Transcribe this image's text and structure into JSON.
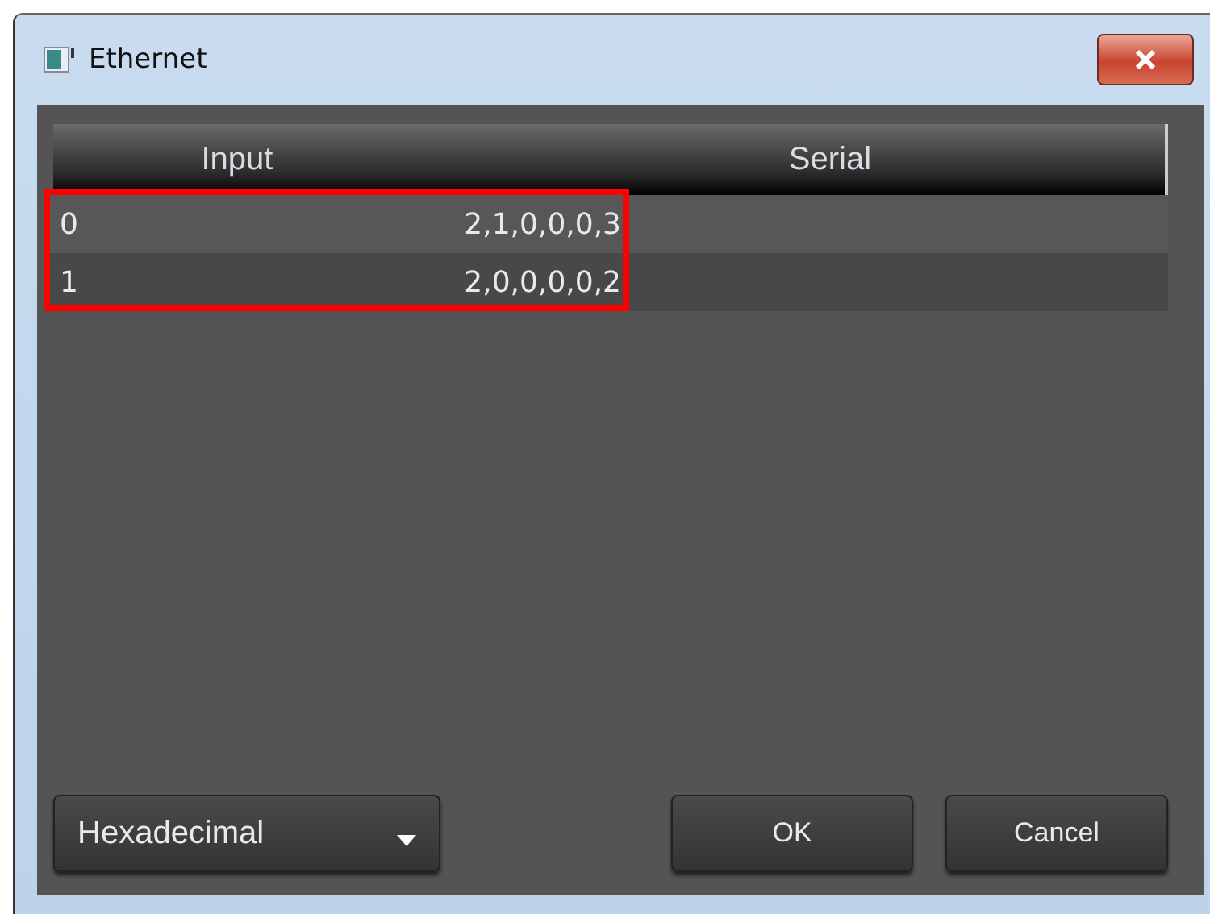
{
  "window": {
    "title": "Ethernet"
  },
  "table": {
    "columns": [
      "Input",
      "Serial"
    ],
    "rows": [
      {
        "cells": [
          "0",
          "2,1,0,0,0,3"
        ],
        "highlighted": true
      },
      {
        "cells": [
          "1",
          "2,0,0,0,0,2"
        ],
        "highlighted": true
      }
    ]
  },
  "format_dropdown": {
    "value": "Hexadecimal"
  },
  "buttons": [
    "OK",
    "Cancel"
  ]
}
